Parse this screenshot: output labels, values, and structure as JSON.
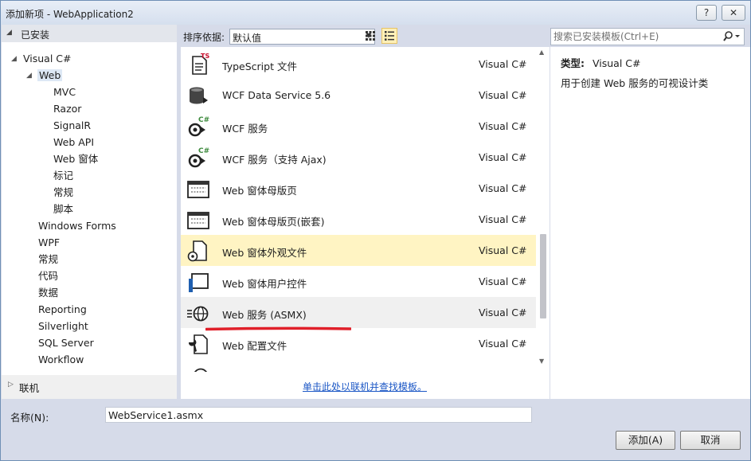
{
  "window": {
    "title": "添加新项 - WebApplication2",
    "help_label": "?",
    "close_label": "✕"
  },
  "tree": {
    "header": "已安装",
    "items": [
      {
        "label": "Visual C#"
      },
      {
        "label": "Web"
      },
      {
        "label": "MVC"
      },
      {
        "label": "Razor"
      },
      {
        "label": "SignalR"
      },
      {
        "label": "Web API"
      },
      {
        "label": "Web 窗体"
      },
      {
        "label": "标记"
      },
      {
        "label": "常规"
      },
      {
        "label": "脚本"
      },
      {
        "label": "Windows Forms"
      },
      {
        "label": "WPF"
      },
      {
        "label": "常规"
      },
      {
        "label": "代码"
      },
      {
        "label": "数据"
      },
      {
        "label": "Reporting"
      },
      {
        "label": "Silverlight"
      },
      {
        "label": "SQL Server"
      },
      {
        "label": "Workflow"
      }
    ],
    "footer": "联机"
  },
  "sort": {
    "label": "排序依据:",
    "value": "默认值"
  },
  "templates": [
    {
      "name": "TypeScript 文件",
      "lang": "Visual C#",
      "icon": "typescript-file-icon"
    },
    {
      "name": "WCF Data Service 5.6",
      "lang": "Visual C#",
      "icon": "data-service-icon"
    },
    {
      "name": "WCF 服务",
      "lang": "Visual C#",
      "icon": "wcf-service-icon"
    },
    {
      "name": "WCF 服务（支持 Ajax)",
      "lang": "Visual C#",
      "icon": "wcf-ajax-service-icon"
    },
    {
      "name": "Web 窗体母版页",
      "lang": "Visual C#",
      "icon": "master-page-icon"
    },
    {
      "name": "Web 窗体母版页(嵌套)",
      "lang": "Visual C#",
      "icon": "nested-master-page-icon"
    },
    {
      "name": "Web 窗体外观文件",
      "lang": "Visual C#",
      "icon": "skin-file-icon"
    },
    {
      "name": "Web 窗体用户控件",
      "lang": "Visual C#",
      "icon": "user-control-icon"
    },
    {
      "name": "Web 服务 (ASMX)",
      "lang": "Visual C#",
      "icon": "web-service-icon"
    },
    {
      "name": "Web 配置文件",
      "lang": "Visual C#",
      "icon": "web-config-icon"
    }
  ],
  "online_link": "单击此处以联机并查找模板。",
  "search": {
    "placeholder": "搜索已安装模板(Ctrl+E)"
  },
  "details": {
    "type_label": "类型:",
    "type_value": "Visual C#",
    "description": "用于创建 Web 服务的可视设计类"
  },
  "bottom": {
    "name_label": "名称(N):",
    "name_value": "WebService1.asmx",
    "add_label": "添加(A)",
    "cancel_label": "取消"
  },
  "colors": {
    "selected_row": "#fff4c3",
    "accent_green": "#3c8a3c",
    "annotation_red": "#e0202a"
  }
}
